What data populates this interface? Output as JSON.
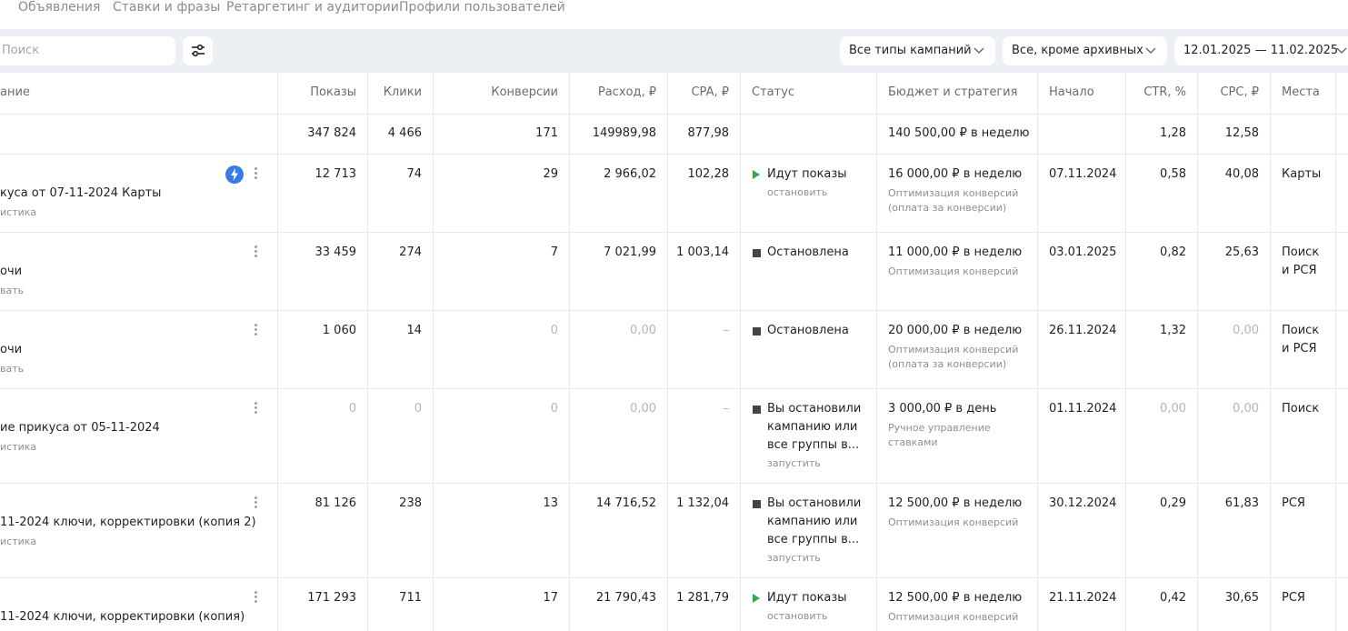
{
  "tabs": [
    "Объявления",
    "Ставки и фразы",
    "Ретаргетинг и аудитории",
    "Профили пользователей"
  ],
  "search": {
    "placeholder": "Поиск"
  },
  "filters": {
    "campaign_types": "Все типы кампаний",
    "archive": "Все, кроме архивных",
    "date_range": "12.01.2025 — 11.02.2025"
  },
  "columns": {
    "name": "ание",
    "impressions": "Показы",
    "clicks": "Клики",
    "conversions": "Конверсии",
    "spend": "Расход, ₽",
    "cpa": "CPA, ₽",
    "status": "Статус",
    "budget": "Бюджет и стратегия",
    "start": "Начало",
    "ctr": "CTR, %",
    "cpc": "CPC, ₽",
    "places": "Места"
  },
  "totals": {
    "impressions": "347 824",
    "clicks": "4 466",
    "conversions": "171",
    "spend": "149989,98",
    "cpa": "877,98",
    "budget": "140 500,00 ₽ в неделю",
    "ctr": "1,28",
    "cpc": "12,58"
  },
  "rows": [
    {
      "name": "куса от 07-11-2024 Карты",
      "name_sub": "истика",
      "impressions": "12 713",
      "clicks": "74",
      "conversions": "29",
      "spend": "2 966,02",
      "cpa": "102,28",
      "status": "Идут показы",
      "status_action": "остановить",
      "budget": "16 000,00 ₽ в неделю",
      "strategy": "Оптимизация конверсий",
      "strategy2": "(оплата за конверсии)",
      "start": "07.11.2024",
      "ctr": "0,58",
      "cpc": "40,08",
      "places": "Карты",
      "places2": ""
    },
    {
      "name": "очи",
      "name_sub": "вать",
      "impressions": "33 459",
      "clicks": "274",
      "conversions": "7",
      "spend": "7 021,99",
      "cpa": "1 003,14",
      "status": "Остановлена",
      "status_action": "",
      "budget": "11 000,00 ₽ в неделю",
      "strategy": "Оптимизация конверсий",
      "strategy2": "",
      "start": "03.01.2025",
      "ctr": "0,82",
      "cpc": "25,63",
      "places": "Поиск",
      "places2": "и РСЯ"
    },
    {
      "name": "очи",
      "name_sub": "вать",
      "impressions": "1 060",
      "clicks": "14",
      "conversions": "0",
      "spend": "0,00",
      "cpa": "–",
      "status": "Остановлена",
      "status_action": "",
      "budget": "20 000,00 ₽ в неделю",
      "strategy": "Оптимизация конверсий",
      "strategy2": "(оплата за конверсии)",
      "start": "26.11.2024",
      "ctr": "1,32",
      "cpc": "0,00",
      "places": "Поиск",
      "places2": "и РСЯ"
    },
    {
      "name": "ие прикуса от 05-11-2024",
      "name_sub": "истика",
      "impressions": "0",
      "clicks": "0",
      "conversions": "0",
      "spend": "0,00",
      "cpa": "–",
      "status_l1": "Вы остановили",
      "status_l2": "кампанию или",
      "status_l3": "все группы в...",
      "status_action": "запустить",
      "budget": "3 000,00 ₽ в день",
      "strategy": "Ручное управление",
      "strategy2": "ставками",
      "start": "01.11.2024",
      "ctr": "0,00",
      "cpc": "0,00",
      "places": "Поиск",
      "places2": ""
    },
    {
      "name": "11-2024 ключи, корректировки (копия 2)",
      "name_sub": "истика",
      "impressions": "81 126",
      "clicks": "238",
      "conversions": "13",
      "spend": "14 716,52",
      "cpa": "1 132,04",
      "status_l1": "Вы остановили",
      "status_l2": "кампанию или",
      "status_l3": "все группы в...",
      "status_action": "запустить",
      "budget": "12 500,00 ₽ в неделю",
      "strategy": "Оптимизация конверсий",
      "strategy2": "",
      "start": "30.12.2024",
      "ctr": "0,29",
      "cpc": "61,83",
      "places": "РСЯ",
      "places2": ""
    },
    {
      "name": "11-2024 ключи, корректировки (копия)",
      "name_sub": "",
      "impressions": "171 293",
      "clicks": "711",
      "conversions": "17",
      "spend": "21 790,43",
      "cpa": "1 281,79",
      "status": "Идут показы",
      "status_action": "остановить",
      "budget": "12 500,00 ₽ в неделю",
      "strategy": "Оптимизация конверсий",
      "strategy2": "",
      "start": "21.11.2024",
      "ctr": "0,42",
      "cpc": "30,65",
      "places": "РСЯ",
      "places2": ""
    }
  ],
  "icons": {
    "filter": "sliders-icon",
    "chevron": "chevron-down-icon",
    "bolt": "lightning-icon",
    "menu": "kebab-menu-icon"
  },
  "colors": {
    "toolbar_bg": "#eceff3",
    "running": "#3aa655",
    "accent": "#3a79e8"
  }
}
